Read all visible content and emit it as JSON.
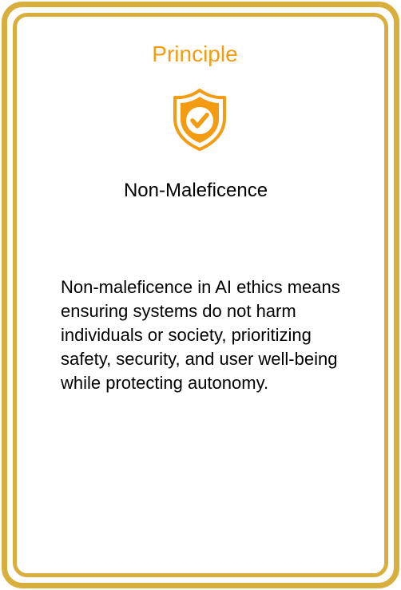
{
  "card": {
    "category": "Principle",
    "icon": "shield-check-icon",
    "title": "Non-Maleficence",
    "description": "Non-maleficence in AI ethics means ensuring systems do not harm individuals or society, prioritizing safety, security, and user well-being while protecting autonomy."
  },
  "colors": {
    "border": "#d8ae3d",
    "accent": "#f39c12",
    "text": "#000000"
  }
}
